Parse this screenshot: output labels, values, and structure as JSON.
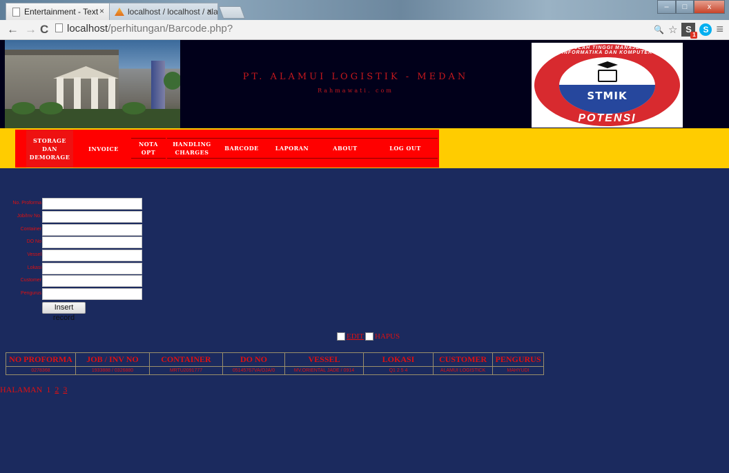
{
  "browser": {
    "tabs": [
      {
        "title": "Entertainment - Text",
        "close": "×"
      },
      {
        "title": "localhost / localhost / ala",
        "close": "×"
      }
    ],
    "address_host": "localhost",
    "address_path": "/perhitungan/Barcode.php?",
    "nav": {
      "back": "←",
      "forward": "→",
      "reload": "C"
    },
    "ext_s": "S",
    "ext_skype": "S",
    "menu_icon": "≡",
    "zoom_icon": "🔍",
    "star_icon": "☆",
    "window_controls": {
      "minimize": "–",
      "maximize": "□",
      "close": "x"
    }
  },
  "header": {
    "title": "PT. ALAMUI LOGISTIK - MEDAN",
    "subtitle": "Rahmawati. com",
    "logo": {
      "text_top": "SEKOLAH TINGGI MANAJEMEN INFORMATIKA DAN KOMPUTER",
      "text_center": "STMIK",
      "text_bottom": "POTENSI UTAMA"
    }
  },
  "menu": [
    {
      "label": "STORAGE DAN DEMORAGE"
    },
    {
      "label": "INVOICE"
    },
    {
      "label": "NOTA OPT"
    },
    {
      "label": "HANDLING CHARGES"
    },
    {
      "label": "BARCODE"
    },
    {
      "label": "LAPORAN"
    },
    {
      "label": "ABOUT"
    },
    {
      "label": "LOG OUT"
    }
  ],
  "form": {
    "fields": [
      {
        "label": "No. Proforma",
        "value": ""
      },
      {
        "label": "Job/Inv No.",
        "value": ""
      },
      {
        "label": "Container",
        "value": ""
      },
      {
        "label": "DO No",
        "value": ""
      },
      {
        "label": "Vessel",
        "value": ""
      },
      {
        "label": "Lokasi",
        "value": ""
      },
      {
        "label": "Customer",
        "value": ""
      },
      {
        "label": "Pengurus",
        "value": ""
      }
    ],
    "submit": "Insert record"
  },
  "actions": {
    "edit": "EDIT",
    "hapus": "HAPUS"
  },
  "table": {
    "headers": [
      "NO PROFORMA",
      "JOB / INV NO",
      "CONTAINER",
      "DO NO",
      "VESSEL",
      "LOKASI",
      "CUSTOMER",
      "PENGURUS"
    ],
    "rows": [
      [
        "0278368",
        "1933888 / 0326880",
        "MRTU2091777",
        "05145767VA/OJA/0",
        "MV.ORIENTAL JADE / 0914",
        "Q1 2 5 4",
        "ALAMUI LOGISTICK",
        "MAHYUDI"
      ]
    ]
  },
  "paging": {
    "label": "HALAMAN",
    "pages": [
      "1",
      "2",
      "3"
    ]
  }
}
